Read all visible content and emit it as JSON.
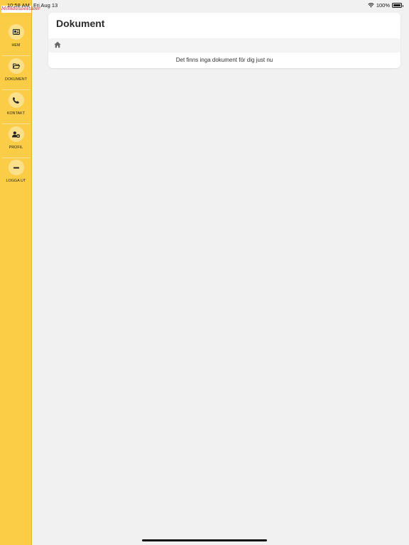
{
  "status_bar": {
    "time": "10:58 AM",
    "date": "Fri Aug 13",
    "battery": "100%",
    "wifi_icon": "wifi-icon",
    "battery_icon": "battery-icon"
  },
  "sidebar": {
    "logo_text": "Mölndalsbostäder",
    "background": "#fbcd46",
    "items": [
      {
        "label": "HEM",
        "icon": "id-card-icon"
      },
      {
        "label": "DOKUMENT",
        "icon": "folder-open-icon"
      },
      {
        "label": "KONTAKT",
        "icon": "phone-icon"
      },
      {
        "label": "PROFIL",
        "icon": "user-gear-icon"
      },
      {
        "label": "LOGGA UT",
        "icon": "minus-icon"
      }
    ]
  },
  "main": {
    "title": "Dokument",
    "breadcrumb_icon": "home-icon",
    "empty_message": "Det finns inga dokument för dig just nu"
  }
}
